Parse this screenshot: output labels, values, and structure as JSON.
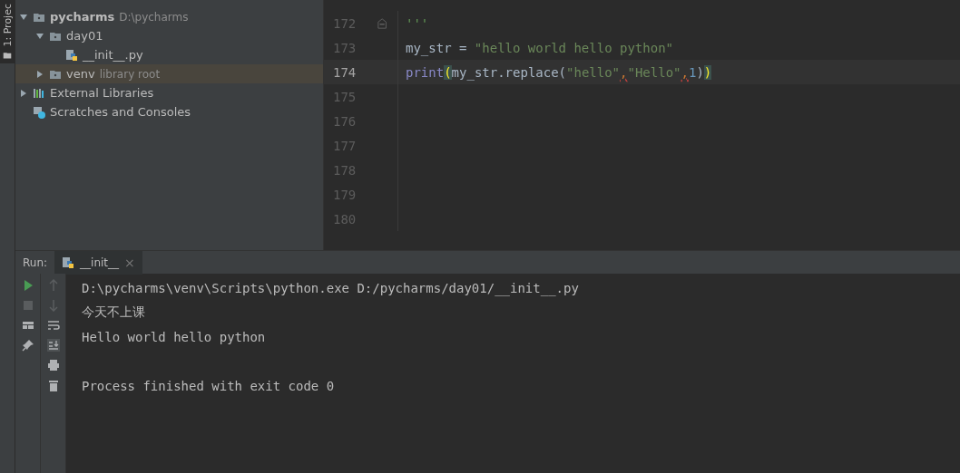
{
  "side_stripe": {
    "label": "1: Projec"
  },
  "project_tree": [
    {
      "kind": "folder",
      "name": "pycharms",
      "hint": "D:\\pycharms",
      "bold": true,
      "expanded": true,
      "selected": false,
      "children": [
        {
          "kind": "folder",
          "name": "day01",
          "expanded": true,
          "selected": false,
          "children": [
            {
              "kind": "python",
              "name": "__init__.py",
              "selected": false
            }
          ]
        },
        {
          "kind": "folder",
          "name": "venv",
          "hint": "library root",
          "expanded": false,
          "selected": true
        }
      ]
    },
    {
      "kind": "libraries",
      "name": "External Libraries",
      "expanded": false,
      "selected": false
    },
    {
      "kind": "scratches",
      "name": "Scratches and Consoles",
      "selected": false
    }
  ],
  "editor": {
    "lines": [
      {
        "number": "172",
        "current": false,
        "fold": true,
        "tokens": [
          {
            "text": "'''",
            "kind": "docstring"
          }
        ]
      },
      {
        "number": "173",
        "current": false,
        "fold": false,
        "tokens": [
          {
            "text": "my_str = ",
            "kind": "plain"
          },
          {
            "text": "\"hello world hello python\"",
            "kind": "string"
          }
        ]
      },
      {
        "number": "174",
        "current": true,
        "fold": false,
        "tokens": [
          {
            "text": "print",
            "kind": "builtin"
          },
          {
            "text": "(",
            "kind": "match"
          },
          {
            "text": "my_str.replace(",
            "kind": "plain"
          },
          {
            "text": "\"hello\"",
            "kind": "string"
          },
          {
            "text": ",",
            "kind": "warn"
          },
          {
            "text": "\"Hello\"",
            "kind": "string"
          },
          {
            "text": ",",
            "kind": "warn"
          },
          {
            "text": "1",
            "kind": "number"
          },
          {
            "text": ")",
            "kind": "plain"
          },
          {
            "text": ")",
            "kind": "match"
          }
        ]
      },
      {
        "number": "175",
        "current": false,
        "fold": false
      },
      {
        "number": "176",
        "current": false,
        "fold": false
      },
      {
        "number": "177",
        "current": false,
        "fold": false
      },
      {
        "number": "178",
        "current": false,
        "fold": false
      },
      {
        "number": "179",
        "current": false,
        "fold": false
      },
      {
        "number": "180",
        "current": false,
        "fold": false
      }
    ]
  },
  "run_panel": {
    "label": "Run:",
    "tab": {
      "title": "__init__",
      "close": "×",
      "selected": true
    },
    "output_blocks": [
      [
        "D:\\pycharms\\venv\\Scripts\\python.exe D:/pycharms/day01/__init__.py",
        "今天不上课",
        "Hello world hello python"
      ],
      [
        "Process finished with exit code 0"
      ]
    ]
  }
}
